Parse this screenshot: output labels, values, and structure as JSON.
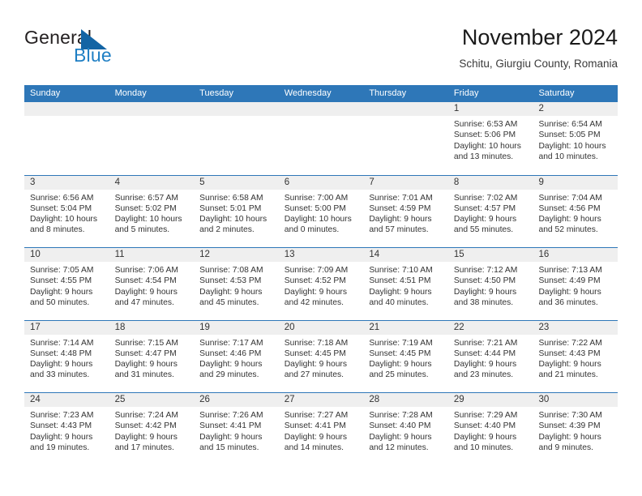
{
  "brand": {
    "name_top": "General",
    "name_bottom": "Blue",
    "triangle_icon": "blue-triangle-icon",
    "accent_color": "#1f7fc4",
    "text_color": "#231f20"
  },
  "header": {
    "title": "November 2024",
    "subtitle": "Schitu, Giurgiu County, Romania"
  },
  "theme": {
    "header_blue": "#2e77b8",
    "band_gray": "#efefef",
    "text": "#333333"
  },
  "weekdays": [
    "Sunday",
    "Monday",
    "Tuesday",
    "Wednesday",
    "Thursday",
    "Friday",
    "Saturday"
  ],
  "weeks": [
    [
      {
        "day": "",
        "sunrise": "",
        "sunset": "",
        "daylight1": "",
        "daylight2": "",
        "empty": true
      },
      {
        "day": "",
        "sunrise": "",
        "sunset": "",
        "daylight1": "",
        "daylight2": "",
        "empty": true
      },
      {
        "day": "",
        "sunrise": "",
        "sunset": "",
        "daylight1": "",
        "daylight2": "",
        "empty": true
      },
      {
        "day": "",
        "sunrise": "",
        "sunset": "",
        "daylight1": "",
        "daylight2": "",
        "empty": true
      },
      {
        "day": "",
        "sunrise": "",
        "sunset": "",
        "daylight1": "",
        "daylight2": "",
        "empty": true
      },
      {
        "day": "1",
        "sunrise": "Sunrise: 6:53 AM",
        "sunset": "Sunset: 5:06 PM",
        "daylight1": "Daylight: 10 hours",
        "daylight2": "and 13 minutes."
      },
      {
        "day": "2",
        "sunrise": "Sunrise: 6:54 AM",
        "sunset": "Sunset: 5:05 PM",
        "daylight1": "Daylight: 10 hours",
        "daylight2": "and 10 minutes."
      }
    ],
    [
      {
        "day": "3",
        "sunrise": "Sunrise: 6:56 AM",
        "sunset": "Sunset: 5:04 PM",
        "daylight1": "Daylight: 10 hours",
        "daylight2": "and 8 minutes."
      },
      {
        "day": "4",
        "sunrise": "Sunrise: 6:57 AM",
        "sunset": "Sunset: 5:02 PM",
        "daylight1": "Daylight: 10 hours",
        "daylight2": "and 5 minutes."
      },
      {
        "day": "5",
        "sunrise": "Sunrise: 6:58 AM",
        "sunset": "Sunset: 5:01 PM",
        "daylight1": "Daylight: 10 hours",
        "daylight2": "and 2 minutes."
      },
      {
        "day": "6",
        "sunrise": "Sunrise: 7:00 AM",
        "sunset": "Sunset: 5:00 PM",
        "daylight1": "Daylight: 10 hours",
        "daylight2": "and 0 minutes."
      },
      {
        "day": "7",
        "sunrise": "Sunrise: 7:01 AM",
        "sunset": "Sunset: 4:59 PM",
        "daylight1": "Daylight: 9 hours",
        "daylight2": "and 57 minutes."
      },
      {
        "day": "8",
        "sunrise": "Sunrise: 7:02 AM",
        "sunset": "Sunset: 4:57 PM",
        "daylight1": "Daylight: 9 hours",
        "daylight2": "and 55 minutes."
      },
      {
        "day": "9",
        "sunrise": "Sunrise: 7:04 AM",
        "sunset": "Sunset: 4:56 PM",
        "daylight1": "Daylight: 9 hours",
        "daylight2": "and 52 minutes."
      }
    ],
    [
      {
        "day": "10",
        "sunrise": "Sunrise: 7:05 AM",
        "sunset": "Sunset: 4:55 PM",
        "daylight1": "Daylight: 9 hours",
        "daylight2": "and 50 minutes."
      },
      {
        "day": "11",
        "sunrise": "Sunrise: 7:06 AM",
        "sunset": "Sunset: 4:54 PM",
        "daylight1": "Daylight: 9 hours",
        "daylight2": "and 47 minutes."
      },
      {
        "day": "12",
        "sunrise": "Sunrise: 7:08 AM",
        "sunset": "Sunset: 4:53 PM",
        "daylight1": "Daylight: 9 hours",
        "daylight2": "and 45 minutes."
      },
      {
        "day": "13",
        "sunrise": "Sunrise: 7:09 AM",
        "sunset": "Sunset: 4:52 PM",
        "daylight1": "Daylight: 9 hours",
        "daylight2": "and 42 minutes."
      },
      {
        "day": "14",
        "sunrise": "Sunrise: 7:10 AM",
        "sunset": "Sunset: 4:51 PM",
        "daylight1": "Daylight: 9 hours",
        "daylight2": "and 40 minutes."
      },
      {
        "day": "15",
        "sunrise": "Sunrise: 7:12 AM",
        "sunset": "Sunset: 4:50 PM",
        "daylight1": "Daylight: 9 hours",
        "daylight2": "and 38 minutes."
      },
      {
        "day": "16",
        "sunrise": "Sunrise: 7:13 AM",
        "sunset": "Sunset: 4:49 PM",
        "daylight1": "Daylight: 9 hours",
        "daylight2": "and 36 minutes."
      }
    ],
    [
      {
        "day": "17",
        "sunrise": "Sunrise: 7:14 AM",
        "sunset": "Sunset: 4:48 PM",
        "daylight1": "Daylight: 9 hours",
        "daylight2": "and 33 minutes."
      },
      {
        "day": "18",
        "sunrise": "Sunrise: 7:15 AM",
        "sunset": "Sunset: 4:47 PM",
        "daylight1": "Daylight: 9 hours",
        "daylight2": "and 31 minutes."
      },
      {
        "day": "19",
        "sunrise": "Sunrise: 7:17 AM",
        "sunset": "Sunset: 4:46 PM",
        "daylight1": "Daylight: 9 hours",
        "daylight2": "and 29 minutes."
      },
      {
        "day": "20",
        "sunrise": "Sunrise: 7:18 AM",
        "sunset": "Sunset: 4:45 PM",
        "daylight1": "Daylight: 9 hours",
        "daylight2": "and 27 minutes."
      },
      {
        "day": "21",
        "sunrise": "Sunrise: 7:19 AM",
        "sunset": "Sunset: 4:45 PM",
        "daylight1": "Daylight: 9 hours",
        "daylight2": "and 25 minutes."
      },
      {
        "day": "22",
        "sunrise": "Sunrise: 7:21 AM",
        "sunset": "Sunset: 4:44 PM",
        "daylight1": "Daylight: 9 hours",
        "daylight2": "and 23 minutes."
      },
      {
        "day": "23",
        "sunrise": "Sunrise: 7:22 AM",
        "sunset": "Sunset: 4:43 PM",
        "daylight1": "Daylight: 9 hours",
        "daylight2": "and 21 minutes."
      }
    ],
    [
      {
        "day": "24",
        "sunrise": "Sunrise: 7:23 AM",
        "sunset": "Sunset: 4:43 PM",
        "daylight1": "Daylight: 9 hours",
        "daylight2": "and 19 minutes."
      },
      {
        "day": "25",
        "sunrise": "Sunrise: 7:24 AM",
        "sunset": "Sunset: 4:42 PM",
        "daylight1": "Daylight: 9 hours",
        "daylight2": "and 17 minutes."
      },
      {
        "day": "26",
        "sunrise": "Sunrise: 7:26 AM",
        "sunset": "Sunset: 4:41 PM",
        "daylight1": "Daylight: 9 hours",
        "daylight2": "and 15 minutes."
      },
      {
        "day": "27",
        "sunrise": "Sunrise: 7:27 AM",
        "sunset": "Sunset: 4:41 PM",
        "daylight1": "Daylight: 9 hours",
        "daylight2": "and 14 minutes."
      },
      {
        "day": "28",
        "sunrise": "Sunrise: 7:28 AM",
        "sunset": "Sunset: 4:40 PM",
        "daylight1": "Daylight: 9 hours",
        "daylight2": "and 12 minutes."
      },
      {
        "day": "29",
        "sunrise": "Sunrise: 7:29 AM",
        "sunset": "Sunset: 4:40 PM",
        "daylight1": "Daylight: 9 hours",
        "daylight2": "and 10 minutes."
      },
      {
        "day": "30",
        "sunrise": "Sunrise: 7:30 AM",
        "sunset": "Sunset: 4:39 PM",
        "daylight1": "Daylight: 9 hours",
        "daylight2": "and 9 minutes."
      }
    ]
  ]
}
